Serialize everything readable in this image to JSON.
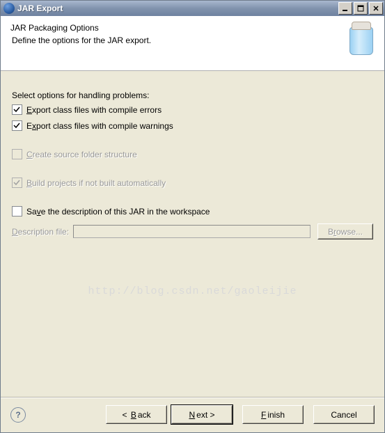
{
  "titlebar": {
    "title": "JAR Export"
  },
  "header": {
    "title": "JAR Packaging Options",
    "subtitle": "Define the options for the JAR export."
  },
  "section": {
    "problems_label": "Select options for handling problems:"
  },
  "options": {
    "export_errors": "Export class files with compile errors",
    "export_warnings": "Export class files with compile warnings",
    "create_source": "Create source folder structure",
    "build_projects": "Build projects if not built automatically",
    "save_description": "Save the description of this JAR in the workspace"
  },
  "file": {
    "label": "Description file:",
    "value": "",
    "browse": "Browse..."
  },
  "buttons": {
    "back": "Back",
    "next": "Next",
    "finish": "Finish",
    "cancel": "Cancel"
  },
  "watermark": "http://blog.csdn.net/gaoleijie"
}
